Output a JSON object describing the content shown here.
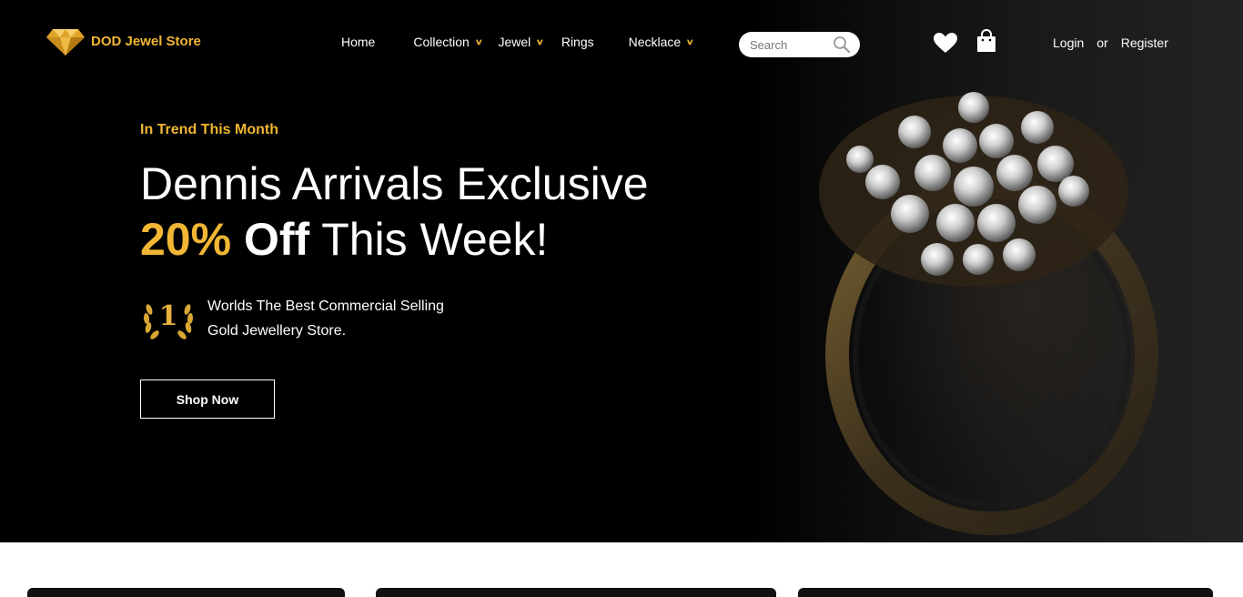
{
  "brand": {
    "name": "DOD Jewel Store",
    "logo_icon": "diamond-icon",
    "accent": "#f1b634"
  },
  "nav": {
    "items": [
      {
        "label": "Home",
        "has_dropdown": false
      },
      {
        "label": "Collection",
        "has_dropdown": true
      },
      {
        "label": "Jewel",
        "has_dropdown": true
      },
      {
        "label": "Rings",
        "has_dropdown": false
      },
      {
        "label": "Necklace",
        "has_dropdown": true
      }
    ],
    "search": {
      "placeholder": "Search",
      "icon": "search-icon"
    },
    "wishlist_icon": "heart-icon",
    "cart_icon": "shopping-bag-icon",
    "login": "Login",
    "or": "or",
    "register": "Register"
  },
  "hero": {
    "eyebrow": "In Trend This Month",
    "line1": "Dennis Arrivals Exclusive",
    "discount": "20%",
    "off": "Off",
    "rest": "This Week!",
    "badge_number": "1",
    "tagline_line1": "Worlds The Best Commercial Selling",
    "tagline_line2": "Gold Jewellery Store.",
    "cta": "Shop Now",
    "image": "diamond-cluster-ring"
  }
}
